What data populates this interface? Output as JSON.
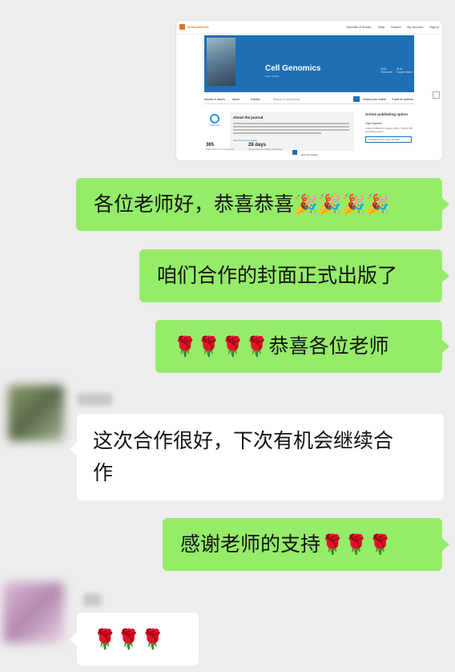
{
  "screenshot_card": {
    "site": "ScienceDirect",
    "top_links": [
      "Journals & Books",
      "Help",
      "Search",
      "My account",
      "Sign in"
    ],
    "journal_title": "Cell Genomics",
    "journal_subtitle": "Open access",
    "banner_meta": [
      "19.8",
      "Citescore",
      "11.5",
      "Impact factor"
    ],
    "nav": [
      "Articles & Issues",
      "About",
      "Publish",
      "Search in this journal",
      "Submit your article",
      "Guide for authors"
    ],
    "about_title": "About the journal",
    "about_link": "View full aims & scope",
    "publisher_logo": "CellPress",
    "option_title": "Article publishing option",
    "option_subtitle": "Open Access",
    "option_note": "Article Publishing Charge (APC): USD 8,050 (excluding taxes)",
    "option_button": "Compare to the other journals",
    "stats": [
      {
        "value": "365",
        "label": "Submission to acceptance"
      },
      {
        "value": "28 days",
        "label": "Acceptance to online publication"
      }
    ],
    "insights_label": "View all insights"
  },
  "messages": [
    {
      "side": "out",
      "text": "各位老师好，恭喜恭喜",
      "emojis": "🎉🎉🎉🎉"
    },
    {
      "side": "out",
      "text": "咱们合作的封面正式出版了"
    },
    {
      "side": "out",
      "emojis": "🌹🌹🌹🌹",
      "text": "恭喜各位老师"
    },
    {
      "side": "in",
      "line1": "这次合作很好，下次有机会继续合",
      "line2": "作"
    },
    {
      "side": "out",
      "text": "感谢老师的支持",
      "emojis": "🌹🌹🌹"
    },
    {
      "side": "in",
      "emojis": "🌹🌹🌹"
    }
  ],
  "colors": {
    "outgoing": "#95ec69",
    "incoming": "#ffffff",
    "background": "#ededed"
  }
}
